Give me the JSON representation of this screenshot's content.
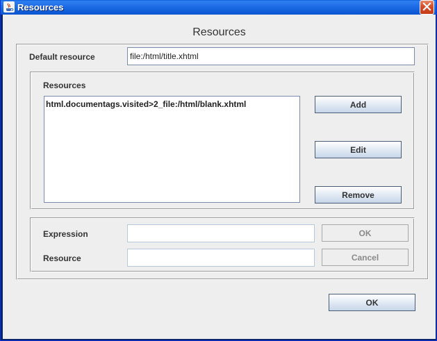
{
  "window": {
    "title": "Resources",
    "icon": "java-icon",
    "close_icon": "close-icon"
  },
  "dialog": {
    "heading": "Resources",
    "default_resource": {
      "label": "Default resource",
      "value": "file:/html/title.xhtml"
    },
    "resources_panel": {
      "label": "Resources",
      "items": [
        "html.documentags.visited>2_file:/html/blank.xhtml"
      ],
      "add_label": "Add",
      "edit_label": "Edit",
      "remove_label": "Remove"
    },
    "editor_panel": {
      "expression_label": "Expression",
      "expression_value": "",
      "resource_label": "Resource",
      "resource_value": "",
      "ok_label": "OK",
      "cancel_label": "Cancel"
    },
    "ok_label": "OK"
  },
  "colors": {
    "titlebar": "#1d6be6",
    "close_button": "#d6502b",
    "panel_background": "#eeeeee"
  }
}
